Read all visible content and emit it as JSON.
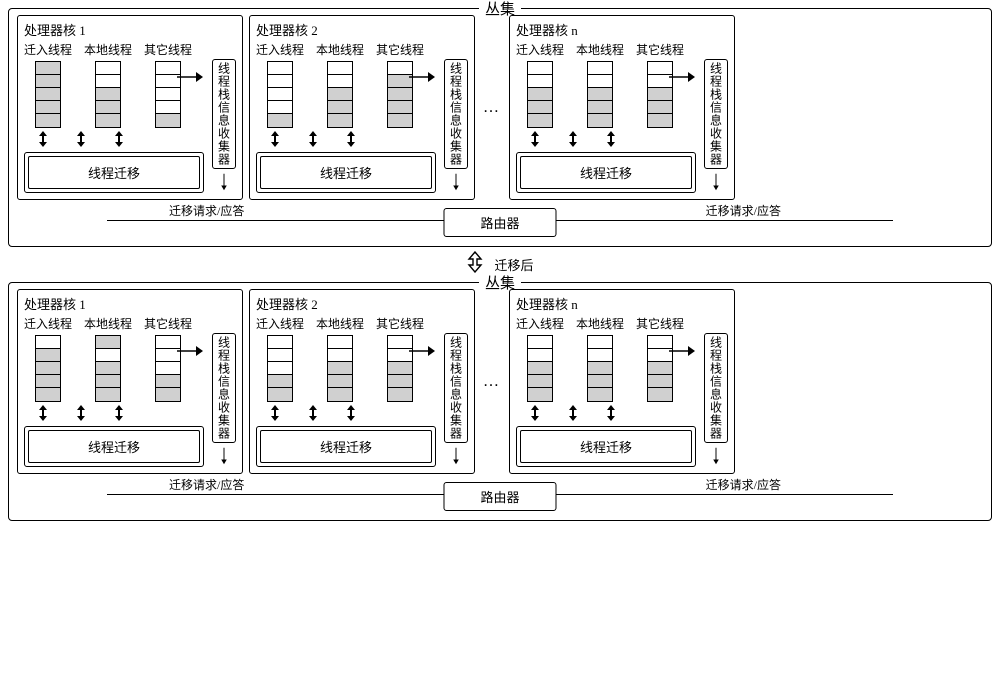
{
  "cluster_title": "丛集",
  "between_label": "迁移后",
  "router_label": "路由器",
  "req_resp_label": "迁移请求/应答",
  "collector_label": "线程栈信息收集器",
  "migration_label": "线程迁移",
  "stack_labels": {
    "in": "迁入线程",
    "local": "本地线程",
    "other": "其它线程"
  },
  "ellipsis": "…",
  "clusters": [
    {
      "cores": [
        {
          "title": "处理器核 1",
          "stacks": {
            "in": [
              1,
              1,
              1,
              1,
              1
            ],
            "local": [
              0,
              0,
              1,
              1,
              1
            ],
            "other": [
              0,
              0,
              0,
              0,
              1
            ]
          }
        },
        {
          "title": "处理器核 2",
          "stacks": {
            "in": [
              0,
              0,
              0,
              0,
              1
            ],
            "local": [
              0,
              0,
              1,
              1,
              1
            ],
            "other": [
              0,
              1,
              1,
              1,
              1
            ]
          }
        },
        {
          "title": "处理器核 n",
          "stacks": {
            "in": [
              0,
              0,
              1,
              1,
              1
            ],
            "local": [
              0,
              0,
              1,
              1,
              1
            ],
            "other": [
              0,
              0,
              1,
              1,
              1
            ]
          }
        }
      ]
    },
    {
      "cores": [
        {
          "title": "处理器核 1",
          "stacks": {
            "in": [
              0,
              1,
              1,
              1,
              1
            ],
            "local": [
              1,
              0,
              1,
              1,
              1
            ],
            "other": [
              0,
              0,
              0,
              1,
              1
            ]
          }
        },
        {
          "title": "处理器核 2",
          "stacks": {
            "in": [
              0,
              0,
              0,
              1,
              1
            ],
            "local": [
              0,
              0,
              1,
              1,
              1
            ],
            "other": [
              0,
              0,
              1,
              1,
              1
            ]
          }
        },
        {
          "title": "处理器核 n",
          "stacks": {
            "in": [
              0,
              0,
              1,
              1,
              1
            ],
            "local": [
              0,
              0,
              1,
              1,
              1
            ],
            "other": [
              0,
              0,
              1,
              1,
              1
            ]
          }
        }
      ]
    }
  ]
}
